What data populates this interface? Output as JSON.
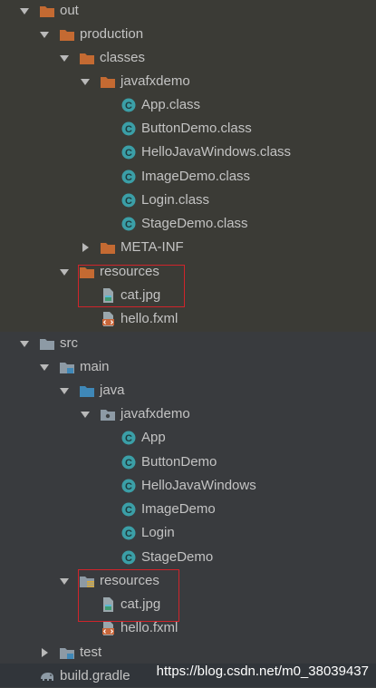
{
  "tree": {
    "out": {
      "label": "out"
    },
    "production": {
      "label": "production"
    },
    "classes": {
      "label": "classes"
    },
    "javafxdemo_out": {
      "label": "javafxdemo"
    },
    "out_classes": [
      {
        "label": "App.class"
      },
      {
        "label": "ButtonDemo.class"
      },
      {
        "label": "HelloJavaWindows.class"
      },
      {
        "label": "ImageDemo.class"
      },
      {
        "label": "Login.class"
      },
      {
        "label": "StageDemo.class"
      }
    ],
    "meta_inf": {
      "label": "META-INF"
    },
    "resources_out": {
      "label": "resources"
    },
    "cat_out": {
      "label": "cat.jpg"
    },
    "hello_out": {
      "label": "hello.fxml"
    },
    "src": {
      "label": "src"
    },
    "main": {
      "label": "main"
    },
    "java": {
      "label": "java"
    },
    "javafxdemo_src": {
      "label": "javafxdemo"
    },
    "src_classes": [
      {
        "label": "App"
      },
      {
        "label": "ButtonDemo"
      },
      {
        "label": "HelloJavaWindows"
      },
      {
        "label": "ImageDemo"
      },
      {
        "label": "Login"
      },
      {
        "label": "StageDemo"
      }
    ],
    "resources_src": {
      "label": "resources"
    },
    "cat_src": {
      "label": "cat.jpg"
    },
    "hello_src": {
      "label": "hello.fxml"
    },
    "test": {
      "label": "test"
    },
    "build_gradle": {
      "label": "build.gradle"
    }
  },
  "watermark": "https://blog.csdn.net/m0_38039437",
  "colors": {
    "folder_orange": "#c46a32",
    "folder_blue": "#3f88b8",
    "folder_gray": "#8d9aa5",
    "class_teal": "#3b9fa7",
    "highlight_red": "#d0242b"
  },
  "icons": {
    "expanded": "chevron-down-icon",
    "collapsed": "chevron-right-icon",
    "excluded_folder": "folder-orange-icon",
    "source_folder": "folder-blue-icon",
    "module_folder": "folder-gray-icon",
    "package": "package-icon",
    "class": "class-c-icon",
    "image_file": "image-file-icon",
    "fxml_file": "fxml-file-icon",
    "resources_folder": "resources-folder-icon",
    "gradle": "gradle-elephant-icon"
  }
}
